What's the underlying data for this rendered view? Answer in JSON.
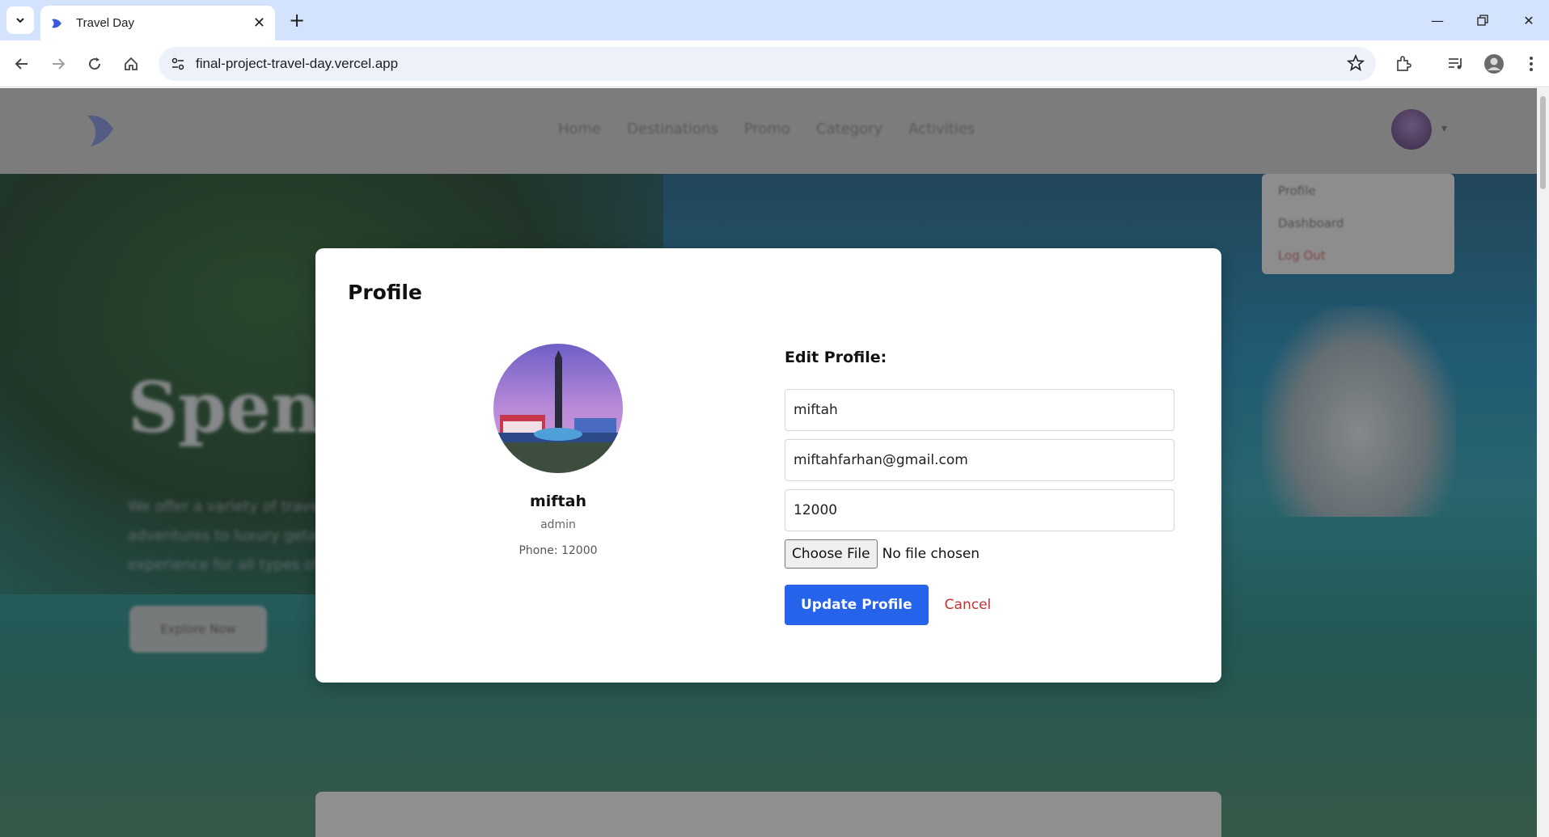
{
  "browser": {
    "tab_title": "Travel Day",
    "url": "final-project-travel-day.vercel.app"
  },
  "background_page": {
    "logo_text": "Travel Day",
    "nav_items": [
      "Home",
      "Destinations",
      "Promo",
      "Category",
      "Activities"
    ],
    "menu_items": [
      "Profile",
      "Dashboard",
      "Log Out"
    ],
    "hero_title": "Spend",
    "hero_text": "We offer a variety of travel adventures to luxury getaways experience for all types of",
    "explore_button": "Explore Now"
  },
  "modal": {
    "title": "Profile",
    "profile": {
      "name": "miftah",
      "role": "admin",
      "phone_text": "Phone: 12000"
    },
    "edit": {
      "title": "Edit Profile:",
      "name_value": "miftah",
      "email_value": "miftahfarhan@gmail.com",
      "phone_value": "12000",
      "file_button": "Choose File",
      "file_status": "No file chosen",
      "update_button": "Update Profile",
      "cancel_link": "Cancel"
    }
  },
  "colors": {
    "primary": "#2563eb",
    "cancel": "#c53030"
  }
}
